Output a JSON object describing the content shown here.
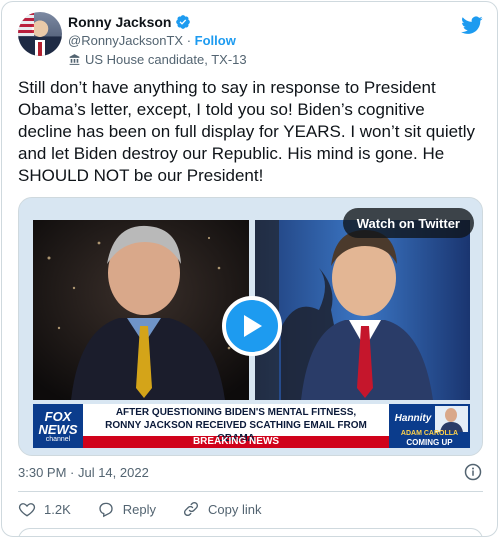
{
  "author": {
    "name": "Ronny Jackson",
    "handle": "@RonnyJacksonTX",
    "separator": "·",
    "follow_label": "Follow",
    "label": "US House candidate, TX-13"
  },
  "tweet": {
    "text": "Still don’t have anything to say in response to President Obama’s letter, except, I told you so! Biden’s cognitive decline has been on full display for YEARS. I won’t sit quietly and let Biden destroy our Republic. His mind is gone. He SHOULD NOT be our President!",
    "timestamp": "3:30 PM · Jul 14, 2022"
  },
  "media": {
    "watch_label": "Watch on Twitter",
    "chyron_line1": "AFTER QUESTIONING BIDEN'S MENTAL FITNESS,",
    "chyron_line2": "RONNY JACKSON RECEIVED SCATHING EMAIL FROM OBAMA",
    "breaking": "BREAKING NEWS",
    "network_top": "FOX",
    "network_mid": "NEWS",
    "network_bottom": "channel",
    "show_logo": "Hannity",
    "guest_name": "ADAM CAROLLA",
    "coming_up": "COMING UP"
  },
  "actions": {
    "like_count": "1.2K",
    "reply_label": "Reply",
    "copy_label": "Copy link"
  },
  "colors": {
    "accent": "#1d9bf0",
    "text": "#0f1419",
    "muted": "#536471",
    "breaking_red": "#d0021b",
    "fox_blue": "#0b3c8c"
  },
  "icons": [
    "verified-badge-icon",
    "twitter-bird-icon",
    "building-icon",
    "play-icon",
    "info-icon",
    "heart-icon",
    "reply-icon",
    "link-icon"
  ]
}
